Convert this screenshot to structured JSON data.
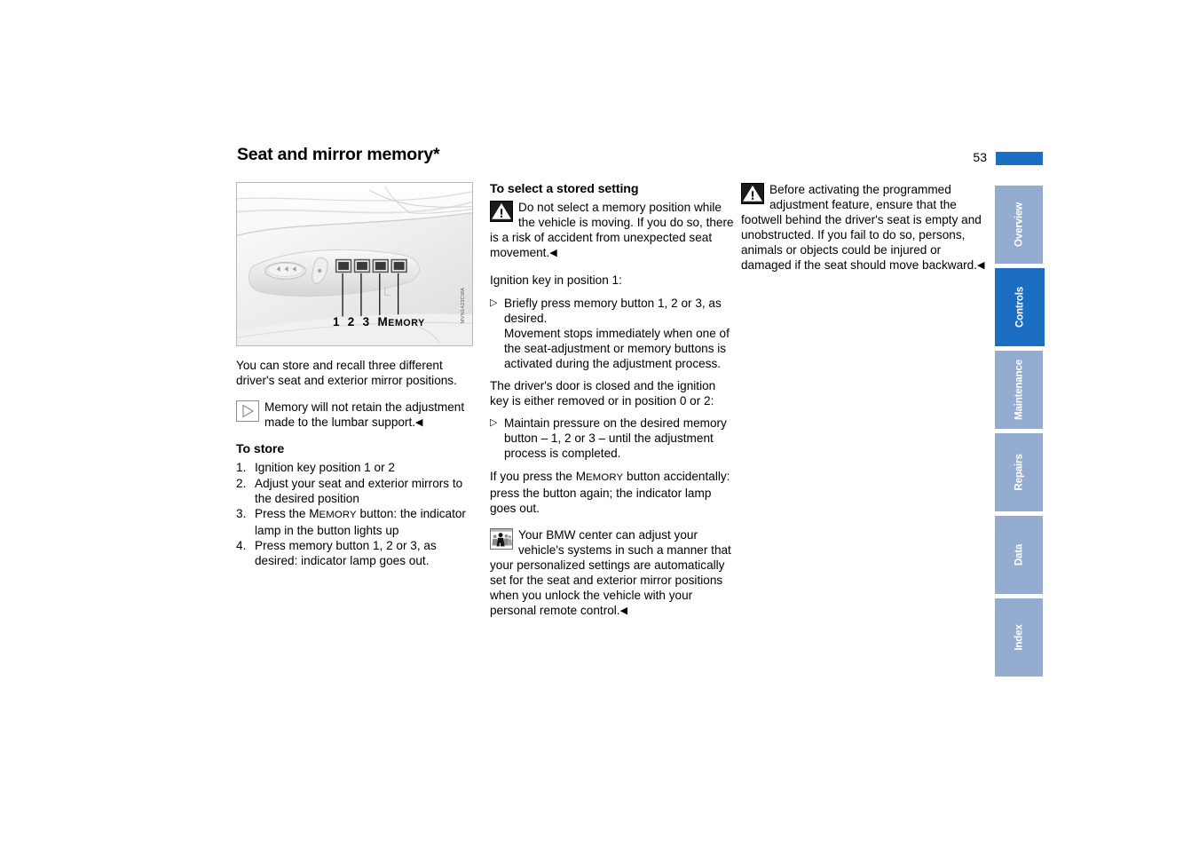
{
  "header": {
    "title": "Seat and mirror memory*",
    "page_number": "53",
    "accent_color": "#1b6ec2"
  },
  "figure": {
    "caption_code": "MVN1423CMA",
    "button_labels": "1  2  3  M",
    "memory_label_rest": "EMORY",
    "alt": "Driver's door seat memory control panel with seat adjustment switches and memory buttons 1, 2, 3 and MEMORY"
  },
  "left_column": {
    "intro": "You can store and recall three different driver's seat and exterior mirror positions.",
    "note": {
      "icon": "note-triangle-icon",
      "text": "Memory will not retain the adjustment made to the lumbar support.",
      "endmark": "◀"
    },
    "to_store": {
      "heading": "To store",
      "steps": [
        "Ignition key position 1 or 2",
        "Adjust your seat and exterior mirrors to the desired position",
        "Press the MEMORY button: the indicator lamp in the button lights up",
        "Press memory button 1, 2 or 3, as desired: indicator lamp goes out."
      ],
      "step3_prefix": "Press the ",
      "step3_smallcaps_head": "M",
      "step3_smallcaps_rest": "EMORY",
      "step3_suffix": " button: the indicator lamp in the button lights up"
    }
  },
  "middle_column": {
    "heading": "To select a stored setting",
    "warning": {
      "icon": "warning-triangle-icon",
      "text": "Do not select a memory position while the vehicle is moving. If you do so, there is a risk of accident from unexpected seat movement.",
      "endmark": "◀"
    },
    "condition_1": "Ignition key in position 1:",
    "bullet_1": "Briefly press memory button 1, 2 or 3, as desired.\nMovement stops immediately when one of the seat-adjustment or memory buttons is activated during the adjustment process.",
    "bullet_1_line1": "Briefly press memory button 1, 2 or 3, as desired.",
    "bullet_1_line2": "Movement stops immediately when one of the seat-adjustment or memory buttons is activated during the adjustment process.",
    "condition_2": "The driver's door is closed and the ignition key is either removed or in position 0 or 2:",
    "bullet_2": "Maintain pressure on the desired memory button – 1, 2 or 3 – until the adjustment process is completed.",
    "accidental_prefix": "If you press the ",
    "accidental_smallcaps_head": "M",
    "accidental_smallcaps_rest": "EMORY",
    "accidental_suffix": " button accidentally: press the button again; the indicator lamp goes out.",
    "service_note": {
      "icon": "service-people-icon",
      "text": "Your BMW center can adjust your vehicle's systems in such a manner that your personalized settings are automatically set for the seat and exterior mirror positions when you unlock the vehicle with your personal remote control.",
      "endmark": "◀"
    }
  },
  "right_column": {
    "warning": {
      "icon": "warning-triangle-icon",
      "text": "Before activating the programmed adjustment feature, ensure that the footwell behind the driver's seat is empty and unobstructed. If you fail to do so, persons, animals or objects could be injured or damaged if the seat should move backward.",
      "endmark": "◀"
    }
  },
  "tabs": {
    "active_color": "#1b6ec2",
    "inactive_color": "#94accf",
    "items": [
      {
        "label": "Overview",
        "active": false
      },
      {
        "label": "Controls",
        "active": true
      },
      {
        "label": "Maintenance",
        "active": false
      },
      {
        "label": "Repairs",
        "active": false
      },
      {
        "label": "Data",
        "active": false
      },
      {
        "label": "Index",
        "active": false
      }
    ]
  }
}
